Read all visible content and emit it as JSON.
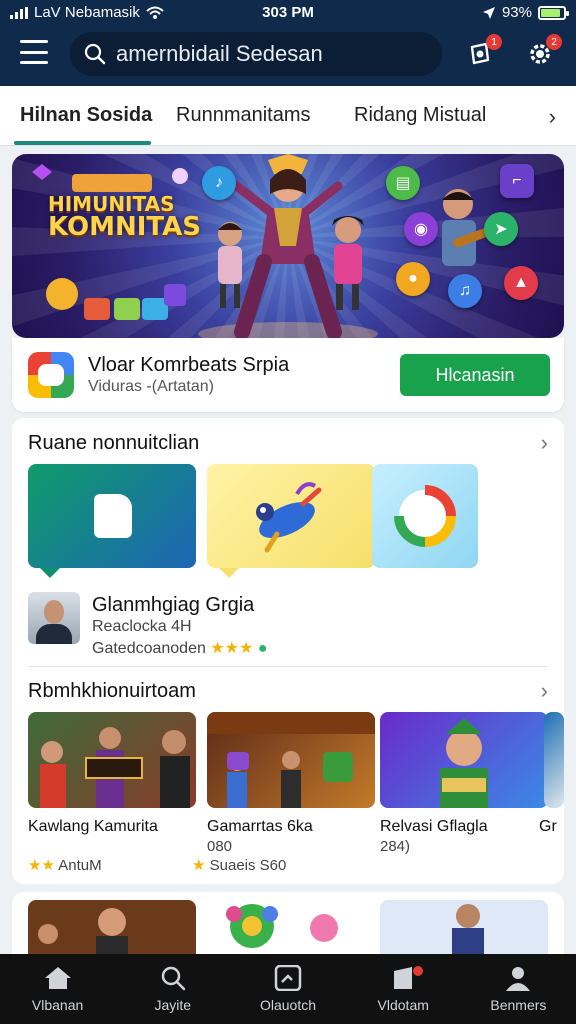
{
  "status_bar": {
    "carrier": "LaV Nebamasik",
    "time": "303 PM",
    "battery": "93%",
    "battery_level": 0.93
  },
  "header": {
    "search_placeholder": "amernbidail Sedesan",
    "notifications_badge": "1",
    "profile_badge": "2"
  },
  "tabs": {
    "items": [
      {
        "label": "Hilnan Sosida",
        "active": true
      },
      {
        "label": "Runnmanitams",
        "active": false
      },
      {
        "label": "Ridang Mistual",
        "active": false
      }
    ]
  },
  "banner": {
    "title_line1": "HIMUNITAS",
    "title_line2": "KOMNITAS"
  },
  "promo": {
    "title": "Vloar Komrbeats Srpia",
    "subtitle": "Viduras -(Artatan)",
    "install_label": "Hlcanasin"
  },
  "section_community": {
    "title": "Ruane nonnuitclian",
    "featured": {
      "title": "Glanmhgiag Grgia",
      "subtitle": "Reaclocka 4H",
      "meta": "Gatedcoanoden"
    }
  },
  "section_apps": {
    "title": "Rbmhkhionuirtoam",
    "items": [
      {
        "title": "Kawlang Kamurita",
        "sub": "",
        "meta": "AntuM"
      },
      {
        "title": "Gamarrtas 6ka",
        "sub": "080",
        "meta": "Suaeis S60"
      },
      {
        "title": "Relvasi Gflagla",
        "sub": "284)",
        "meta": ""
      },
      {
        "title": "Gr",
        "sub": "",
        "meta": ""
      }
    ]
  },
  "bottom_nav": {
    "items": [
      {
        "label": "Vlbanan",
        "icon": "home-icon"
      },
      {
        "label": "Jayite",
        "icon": "discover-icon"
      },
      {
        "label": "Olauotch",
        "icon": "activity-icon"
      },
      {
        "label": "Vldotam",
        "icon": "notifications-icon"
      },
      {
        "label": "Benmers",
        "icon": "profile-icon"
      }
    ]
  },
  "colors": {
    "header_bg": "#0f2a4a",
    "accent": "#1c8b7e",
    "install_button": "#18a24b",
    "nav_bg": "#111111"
  }
}
